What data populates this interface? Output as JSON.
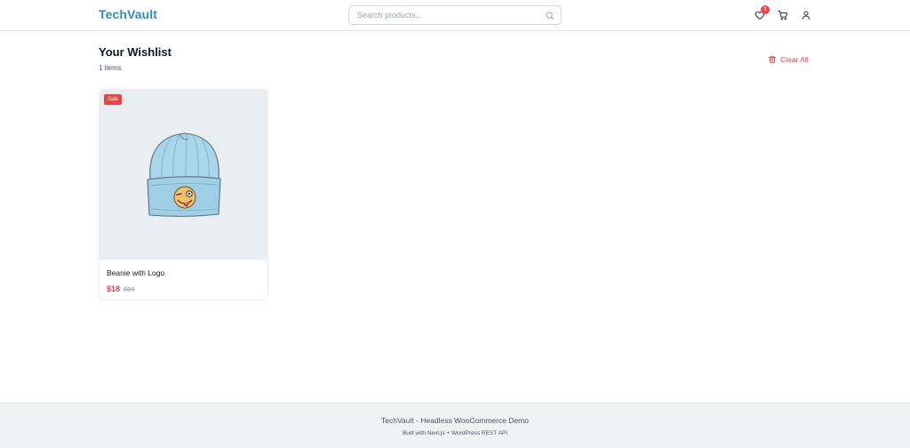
{
  "header": {
    "logo": "TechVault",
    "search": {
      "placeholder": "Search products...",
      "value": ""
    },
    "icons": {
      "wishlist": "heart-icon",
      "cart": "cart-icon",
      "account": "user-icon",
      "search": "search-icon"
    },
    "wishlist_badge": "1"
  },
  "main": {
    "title": "Your Wishlist",
    "item_count": "1 items",
    "clear_all_label": "Clear All",
    "clear_all_icon": "trash-icon"
  },
  "products": [
    {
      "badge": "Sale",
      "name": "Beanie with Logo",
      "sale_price": "$18",
      "regular_price": "$20"
    }
  ],
  "footer": {
    "title": "TechVault - Headless WooCommerce Demo",
    "subtitle": "Built with Next.js + WordPress REST API"
  },
  "colors": {
    "brand": "#2b8fc7",
    "danger": "#ef4444",
    "text": "#111827",
    "muted": "#9ca3af",
    "footer_bg": "#f1f2f4",
    "image_bg": "#e8eef2",
    "beanie": "#a8d6ea"
  }
}
